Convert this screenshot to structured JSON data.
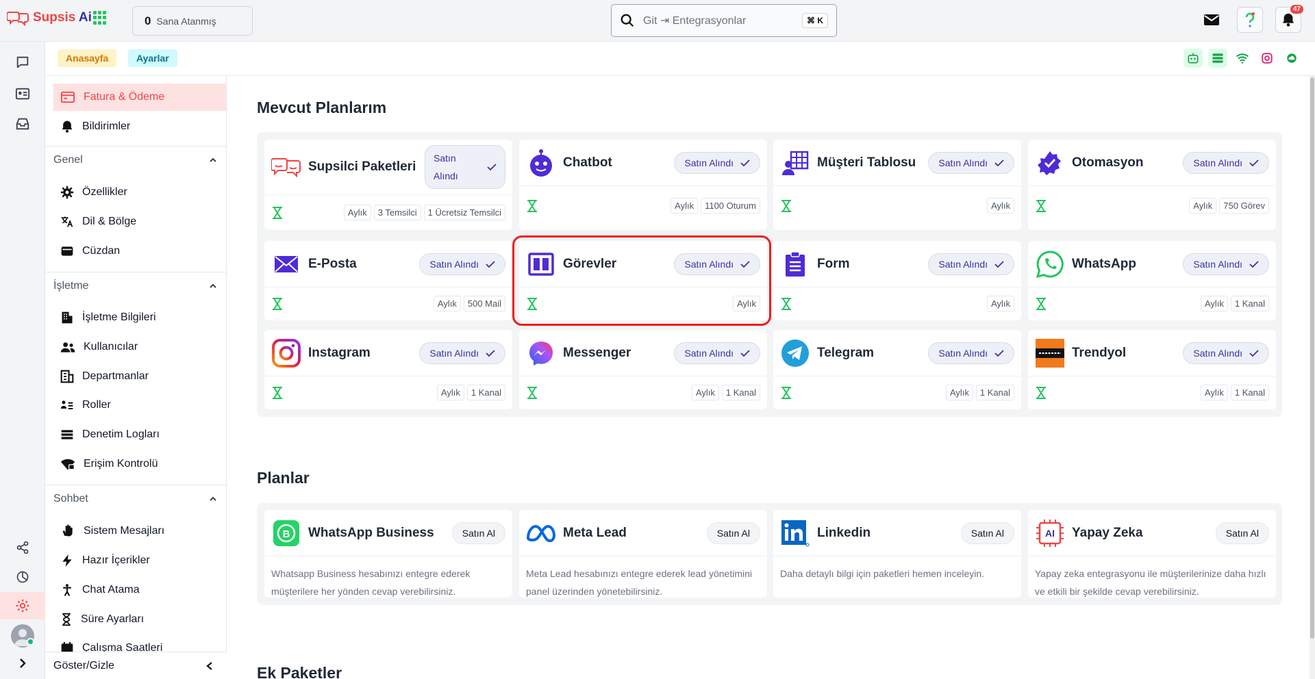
{
  "app": {
    "name_part1": "Supsis",
    "name_part2": " Ai"
  },
  "header": {
    "assigned_count": "0",
    "assigned_label": "Sana Atanmış",
    "search_placeholder": "Git ⇥ Entegrasyonlar",
    "search_shortcut": "⌘ K",
    "notification_count": "47"
  },
  "breadcrumb": {
    "home": "Anasayfa",
    "settings": "Ayarlar"
  },
  "sidebar": {
    "top_items": [
      {
        "label": "Fatura & Ödeme",
        "icon": "invoice-icon",
        "active": true
      },
      {
        "label": "Bildirimler",
        "icon": "bell-icon"
      }
    ],
    "sections": [
      {
        "title": "Genel",
        "items": [
          {
            "label": "Özellikler",
            "icon": "gear-icon"
          },
          {
            "label": "Dil & Bölge",
            "icon": "translate-icon"
          },
          {
            "label": "Cüzdan",
            "icon": "wallet-icon"
          }
        ]
      },
      {
        "title": "İşletme",
        "items": [
          {
            "label": "İşletme Bilgileri",
            "icon": "building-icon"
          },
          {
            "label": "Kullanıcılar",
            "icon": "users-icon"
          },
          {
            "label": "Departmanlar",
            "icon": "department-icon"
          },
          {
            "label": "Roller",
            "icon": "roles-icon"
          },
          {
            "label": "Denetim Logları",
            "icon": "list-icon"
          },
          {
            "label": "Erişim Kontrolü",
            "icon": "access-icon"
          }
        ]
      },
      {
        "title": "Sohbet",
        "items": [
          {
            "label": "Sistem Mesajları",
            "icon": "wave-icon"
          },
          {
            "label": "Hazır İçerikler",
            "icon": "bolt-icon"
          },
          {
            "label": "Chat Atama",
            "icon": "person-icon"
          },
          {
            "label": "Süre Ayarları",
            "icon": "hourglass-icon"
          },
          {
            "label": "Çalışma Saatleri",
            "icon": "calendar-icon"
          }
        ]
      }
    ],
    "footer": "Göster/Gizle"
  },
  "main": {
    "my_plans_title": "Mevcut Planlarım",
    "purchased_label": "Satın Alındı",
    "my_plans": [
      {
        "title": "Supsilci Paketleri",
        "icon": "agents-icon",
        "tags": [
          "Aylık",
          "3 Temsilci",
          "1 Ücretsiz Temsilci"
        ]
      },
      {
        "title": "Chatbot",
        "icon": "chatbot-icon",
        "tags": [
          "Aylık",
          "1100 Oturum"
        ]
      },
      {
        "title": "Müşteri Tablosu",
        "icon": "customer-table-icon",
        "tags": [
          "Aylık"
        ]
      },
      {
        "title": "Otomasyon",
        "icon": "automation-icon",
        "tags": [
          "Aylık",
          "750 Görev"
        ]
      },
      {
        "title": "E-Posta",
        "icon": "mail-icon",
        "tags": [
          "Aylık",
          "500 Mail"
        ]
      },
      {
        "title": "Görevler",
        "icon": "tasks-icon",
        "tags": [
          "Aylık"
        ]
      },
      {
        "title": "Form",
        "icon": "form-icon",
        "tags": [
          "Aylık"
        ]
      },
      {
        "title": "WhatsApp",
        "icon": "whatsapp-icon",
        "tags": [
          "Aylık",
          "1 Kanal"
        ]
      },
      {
        "title": "Instagram",
        "icon": "instagram-icon",
        "tags": [
          "Aylık",
          "1 Kanal"
        ]
      },
      {
        "title": "Messenger",
        "icon": "messenger-icon",
        "tags": [
          "Aylık",
          "1 Kanal"
        ]
      },
      {
        "title": "Telegram",
        "icon": "telegram-icon",
        "tags": [
          "Aylık",
          "1 Kanal"
        ]
      },
      {
        "title": "Trendyol",
        "icon": "trendyol-icon",
        "tags": [
          "Aylık",
          "1 Kanal"
        ]
      }
    ],
    "plans_title": "Planlar",
    "buy_label": "Satın Al",
    "plans": [
      {
        "title": "WhatsApp Business",
        "icon": "whatsapp-business-icon",
        "desc": "Whatsapp Business hesabınızı entegre ederek müşterilere her yönden cevap verebilirsiniz."
      },
      {
        "title": "Meta Lead",
        "icon": "meta-icon",
        "desc": "Meta Lead hesabınızı entegre ederek lead yönetimini panel üzerinden yönetebilirsiniz."
      },
      {
        "title": "Linkedin",
        "icon": "linkedin-icon",
        "desc": "Daha detaylı bilgi için paketleri hemen inceleyin."
      },
      {
        "title": "Yapay Zeka",
        "icon": "ai-icon",
        "desc": "Yapay zeka entegrasyonu ile müşterilerinize daha hızlı ve etkili bir şekilde cevap verebilirsiniz."
      }
    ],
    "extra_title": "Ek Paketler"
  },
  "colors": {
    "accent": "#ef4444",
    "brand": "#3730a3",
    "purple": "#4f2bd6",
    "green": "#22c55e"
  }
}
